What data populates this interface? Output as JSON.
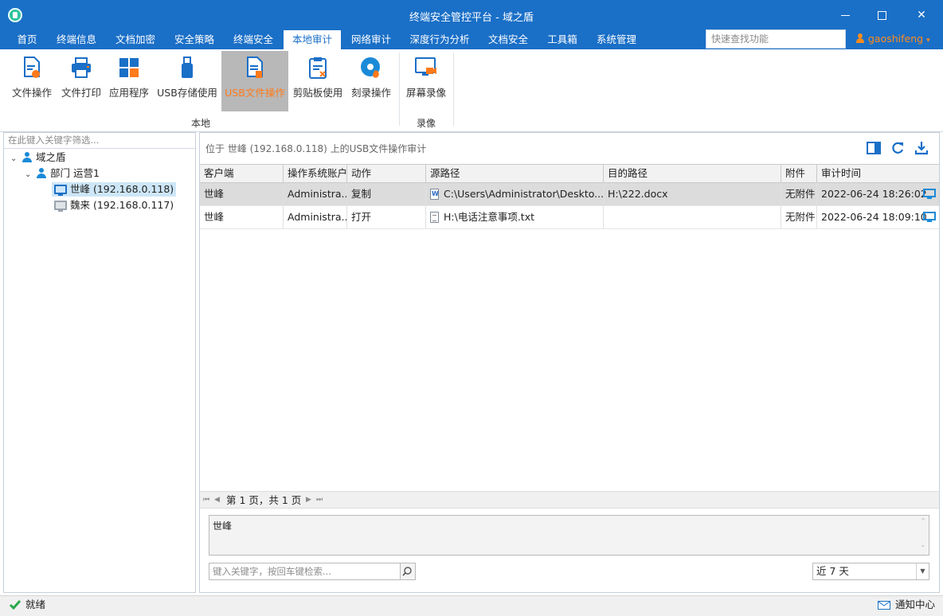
{
  "window": {
    "title": "终端安全管控平台 - 域之盾",
    "min": "—",
    "max": "□",
    "close": "✕"
  },
  "menu": {
    "tabs": [
      "首页",
      "终端信息",
      "文档加密",
      "安全策略",
      "终端安全",
      "本地审计",
      "网络审计",
      "深度行为分析",
      "文档安全",
      "工具箱",
      "系统管理"
    ],
    "active_index": 5,
    "quick_search_placeholder": "快速查找功能",
    "username": "gaoshifeng",
    "user_caret": "▾"
  },
  "ribbon": {
    "buttons": [
      {
        "label": "文件操作",
        "icon": "file-operation-icon"
      },
      {
        "label": "文件打印",
        "icon": "printer-icon"
      },
      {
        "label": "应用程序",
        "icon": "apps-grid-icon"
      },
      {
        "label": "USB存储使用",
        "icon": "usb-drive-icon"
      },
      {
        "label": "USB文件操作",
        "icon": "usb-file-icon",
        "active": true
      },
      {
        "label": "剪贴板使用",
        "icon": "clipboard-icon"
      },
      {
        "label": "刻录操作",
        "icon": "disc-burn-icon"
      },
      {
        "label": "屏幕录像",
        "icon": "screen-record-icon"
      }
    ],
    "groups": [
      "本地",
      "录像"
    ]
  },
  "tree": {
    "filter_placeholder": "在此键入关键字筛选...",
    "nodes": [
      {
        "label": "域之盾",
        "toggle": "⌄"
      },
      {
        "label": "部门 运营1",
        "toggle": "⌄"
      },
      {
        "label": "世峰 (192.168.0.118)",
        "selected": true
      },
      {
        "label": "魏来 (192.168.0.117)",
        "offline": true
      }
    ]
  },
  "main": {
    "location": "位于 世峰 (192.168.0.118) 上的USB文件操作审计",
    "columns": [
      "客户端",
      "操作系统账户",
      "动作",
      "源路径",
      "目的路径",
      "附件",
      "审计时间"
    ],
    "rows": [
      {
        "client": "世峰",
        "account": "Administra...",
        "action": "复制",
        "src": "C:\\Users\\Administrator\\Deskto...",
        "src_type": "word",
        "dst": "H:\\222.docx",
        "attach": "无附件",
        "time": "2022-06-24 18:26:02"
      },
      {
        "client": "世峰",
        "account": "Administra...",
        "action": "打开",
        "src": "H:\\电话注意事项.txt",
        "src_type": "txt",
        "dst": "",
        "attach": "无附件",
        "time": "2022-06-24 18:09:10"
      }
    ],
    "pager": {
      "text": "第 1 页，共 1 页",
      "first": "⏮",
      "prev": "◀",
      "next": "▶",
      "last": "⏭"
    },
    "detail_text": "世峰",
    "search_placeholder": "键入关键字，按回车键检索...",
    "date_range": "近 7 天",
    "dropdown_caret": "▼"
  },
  "status": {
    "ready": "就绪",
    "notify": "通知中心"
  },
  "colors": {
    "brand": "#1a6fc7",
    "accent": "#ff7a1a",
    "ok": "#2aa84a"
  }
}
